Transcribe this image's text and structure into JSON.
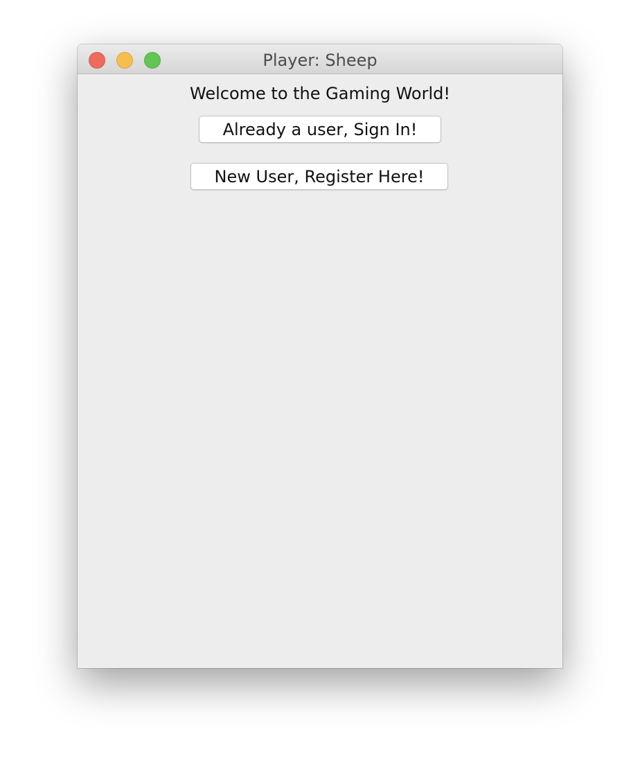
{
  "window": {
    "title": "Player: Sheep",
    "controls": {
      "close_color": "#ee6a5f",
      "minimize_color": "#f5be4f",
      "zoom_color": "#62c554"
    }
  },
  "main": {
    "welcome_text": "Welcome to the Gaming World!",
    "sign_in_label": "Already a user, Sign In!",
    "register_label": "New User, Register Here!"
  }
}
